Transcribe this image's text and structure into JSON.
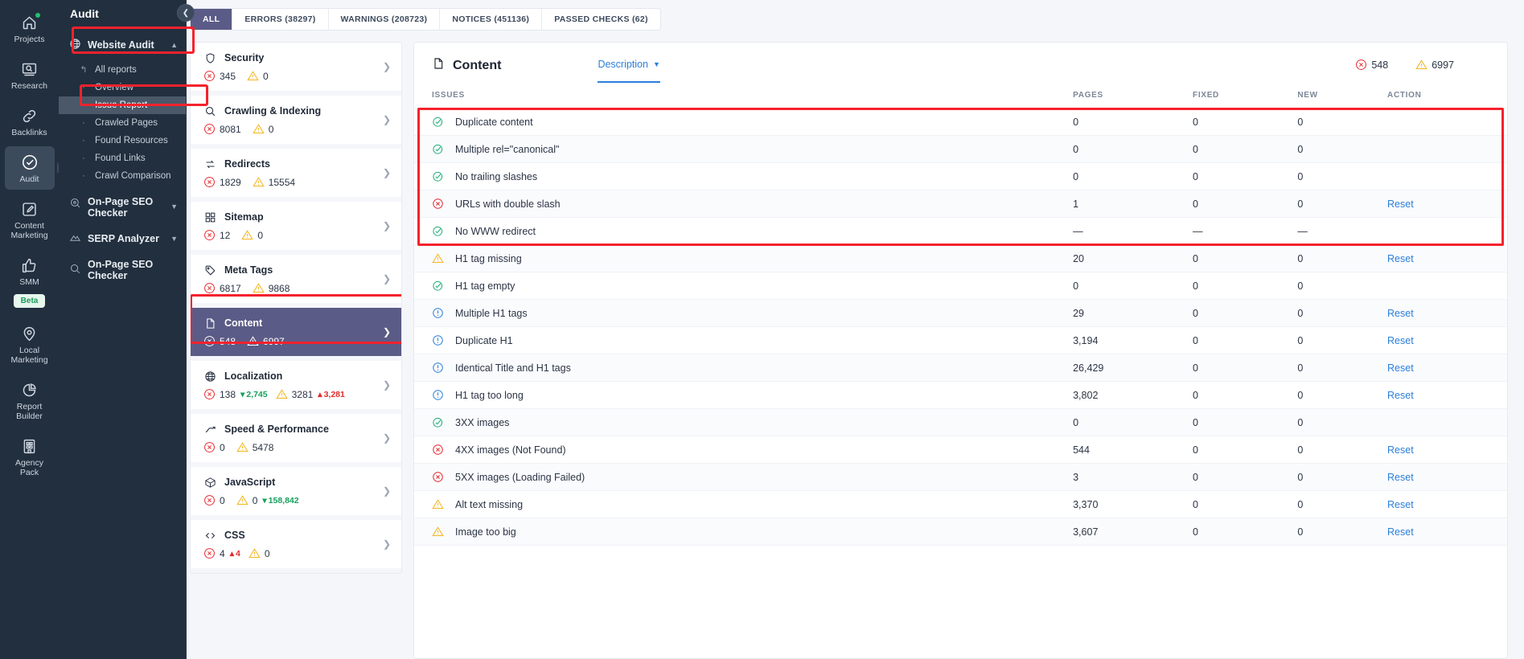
{
  "rail": {
    "items": [
      {
        "label": "Projects",
        "icon": "home-icon",
        "badge": true,
        "active": false
      },
      {
        "label": "Research",
        "icon": "research-icon",
        "active": false
      },
      {
        "label": "Backlinks",
        "icon": "link-icon",
        "active": false
      },
      {
        "label": "Audit",
        "icon": "audit-check-icon",
        "active": true
      },
      {
        "label": "Content\nMarketing",
        "icon": "pencil-square-icon",
        "active": false
      },
      {
        "label": "SMM",
        "icon": "thumbs-up-icon",
        "active": false,
        "beta": "Beta"
      },
      {
        "label": "Local\nMarketing",
        "icon": "map-pin-icon",
        "active": false
      },
      {
        "label": "Report\nBuilder",
        "icon": "pie-chart-icon",
        "active": false
      },
      {
        "label": "Agency\nPack",
        "icon": "building-icon",
        "active": false
      }
    ]
  },
  "nav": {
    "title": "Audit",
    "collapse_icon": "chevron-left-icon",
    "groups": [
      {
        "label": "Website Audit",
        "icon": "globe-icon",
        "chevron": "chevron-up-icon",
        "expanded": true,
        "highlighted": true,
        "items": [
          {
            "label": "All reports",
            "bullet": "↰",
            "active": false
          },
          {
            "label": "Overview",
            "bullet": "·",
            "active": false
          },
          {
            "label": "Issue Report",
            "bullet": "•",
            "active": true,
            "highlighted": true
          },
          {
            "label": "Crawled Pages",
            "bullet": "·",
            "active": false
          },
          {
            "label": "Found Resources",
            "bullet": "·",
            "active": false
          },
          {
            "label": "Found Links",
            "bullet": "·",
            "active": false
          },
          {
            "label": "Crawl Comparison",
            "bullet": "·",
            "active": false
          }
        ]
      },
      {
        "label": "On-Page SEO Checker",
        "icon": "target-search-icon",
        "chevron": "chevron-down-icon",
        "expanded": false,
        "items": []
      },
      {
        "label": "SERP Analyzer",
        "icon": "mountain-chart-icon",
        "chevron": "chevron-down-icon",
        "expanded": false,
        "items": []
      },
      {
        "label": "On-Page SEO Checker",
        "icon": "magnifier-icon",
        "chevron": "",
        "expanded": false,
        "items": []
      }
    ]
  },
  "tabs": [
    {
      "label": "ALL",
      "active": true
    },
    {
      "label": "ERRORS (38297)",
      "active": false
    },
    {
      "label": "WARNINGS (208723)",
      "active": false
    },
    {
      "label": "NOTICES (451136)",
      "active": false
    },
    {
      "label": "PASSED CHECKS (62)",
      "active": false
    }
  ],
  "categories": [
    {
      "name": "Security",
      "icon": "shield-icon",
      "errors": "345",
      "warnings": "0",
      "selected": false
    },
    {
      "name": "Crawling & Indexing",
      "icon": "magnifier-icon",
      "errors": "8081",
      "warnings": "0",
      "selected": false
    },
    {
      "name": "Redirects",
      "icon": "redirect-arrows-icon",
      "errors": "1829",
      "warnings": "15554",
      "selected": false
    },
    {
      "name": "Sitemap",
      "icon": "grid-squares-icon",
      "errors": "12",
      "warnings": "0",
      "selected": false
    },
    {
      "name": "Meta Tags",
      "icon": "tag-icon",
      "errors": "6817",
      "warnings": "9868",
      "selected": false
    },
    {
      "name": "Content",
      "icon": "document-icon",
      "errors": "548",
      "warnings": "6997",
      "selected": true,
      "highlighted": true
    },
    {
      "name": "Localization",
      "icon": "globe-icon",
      "errors": "138",
      "errors_delta": "2,745",
      "errors_delta_dir": "down",
      "warnings": "3281",
      "warnings_delta": "3,281",
      "warnings_delta_dir": "up",
      "selected": false
    },
    {
      "name": "Speed & Performance",
      "icon": "trend-line-icon",
      "errors": "0",
      "warnings": "5478",
      "selected": false
    },
    {
      "name": "JavaScript",
      "icon": "cube-icon",
      "errors": "0",
      "warnings": "0",
      "warnings_delta": "158,842",
      "warnings_delta_dir": "down",
      "selected": false
    },
    {
      "name": "CSS",
      "icon": "code-brackets-icon",
      "errors": "4",
      "errors_delta": "4",
      "errors_delta_dir": "up",
      "warnings": "0",
      "selected": false
    }
  ],
  "content": {
    "title": "Content",
    "title_icon": "document-icon",
    "description_tab": "Description",
    "description_chevron": "chevron-down-icon",
    "error_count": "548",
    "warning_count": "6997",
    "columns": [
      "ISSUES",
      "PAGES",
      "FIXED",
      "NEW",
      "ACTION"
    ],
    "rows": [
      {
        "status": "pass",
        "issue": "Duplicate content",
        "pages": "0",
        "fixed": "0",
        "new": "0",
        "action": "",
        "highlighted": true
      },
      {
        "status": "pass",
        "issue": "Multiple rel=\"canonical\"",
        "pages": "0",
        "fixed": "0",
        "new": "0",
        "action": "",
        "highlighted": true
      },
      {
        "status": "pass",
        "issue": "No trailing slashes",
        "pages": "0",
        "fixed": "0",
        "new": "0",
        "action": "",
        "highlighted": true
      },
      {
        "status": "error",
        "issue": "URLs with double slash",
        "pages": "1",
        "fixed": "0",
        "new": "0",
        "action": "Reset",
        "highlighted": true
      },
      {
        "status": "pass",
        "issue": "No WWW redirect",
        "pages": "—",
        "fixed": "—",
        "new": "—",
        "action": "",
        "highlighted": true
      },
      {
        "status": "warning",
        "issue": "H1 tag missing",
        "pages": "20",
        "fixed": "0",
        "new": "0",
        "action": "Reset"
      },
      {
        "status": "pass",
        "issue": "H1 tag empty",
        "pages": "0",
        "fixed": "0",
        "new": "0",
        "action": ""
      },
      {
        "status": "notice",
        "issue": "Multiple H1 tags",
        "pages": "29",
        "fixed": "0",
        "new": "0",
        "action": "Reset"
      },
      {
        "status": "notice",
        "issue": "Duplicate H1",
        "pages": "3,194",
        "fixed": "0",
        "new": "0",
        "action": "Reset"
      },
      {
        "status": "notice",
        "issue": "Identical Title and H1 tags",
        "pages": "26,429",
        "fixed": "0",
        "new": "0",
        "action": "Reset"
      },
      {
        "status": "notice",
        "issue": "H1 tag too long",
        "pages": "3,802",
        "fixed": "0",
        "new": "0",
        "action": "Reset"
      },
      {
        "status": "pass",
        "issue": "3XX images",
        "pages": "0",
        "fixed": "0",
        "new": "0",
        "action": ""
      },
      {
        "status": "error",
        "issue": "4XX images (Not Found)",
        "pages": "544",
        "fixed": "0",
        "new": "0",
        "action": "Reset"
      },
      {
        "status": "error",
        "issue": "5XX images (Loading Failed)",
        "pages": "3",
        "fixed": "0",
        "new": "0",
        "action": "Reset"
      },
      {
        "status": "warning",
        "issue": "Alt text missing",
        "pages": "3,370",
        "fixed": "0",
        "new": "0",
        "action": "Reset"
      },
      {
        "status": "warning",
        "issue": "Image too big",
        "pages": "3,607",
        "fixed": "0",
        "new": "0",
        "action": "Reset"
      }
    ]
  },
  "colors": {
    "accent": "#5b5b87",
    "error": "#e8262d",
    "warning": "#f5b521",
    "notice": "#2a7fdc",
    "pass": "#25b07a",
    "link": "#2a7fdc",
    "highlight": "#f5222d",
    "sidebar": "#222f3e"
  }
}
